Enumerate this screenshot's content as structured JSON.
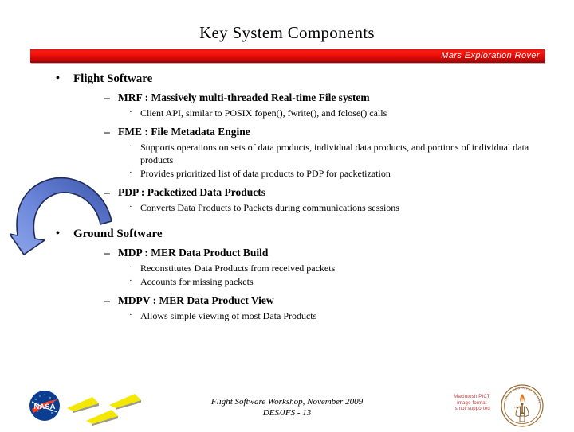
{
  "slide": {
    "title": "Key System Components",
    "banner_label": "Mars Exploration Rover",
    "banner_color": "#ee0d08",
    "arrow_color": "#6B86DB"
  },
  "content": [
    {
      "level": 1,
      "bullet": "•",
      "text": "Flight Software"
    },
    {
      "level": 2,
      "bullet": "–",
      "text": "MRF :  Massively multi-threaded Real-time File system"
    },
    {
      "level": 3,
      "bullet": "·",
      "text": "Client API, similar to POSIX fopen(), fwrite(), and fclose() calls"
    },
    {
      "level": 2,
      "bullet": "–",
      "text": "FME :  File Metadata Engine"
    },
    {
      "level": 3,
      "bullet": "·",
      "text": "Supports operations on sets of data products, individual data products, and portions of individual data products"
    },
    {
      "level": 3,
      "bullet": "·",
      "text": "Provides prioritized list of data products to PDP for packetization"
    },
    {
      "level": 2,
      "bullet": "–",
      "text": "PDP :  Packetized Data Products"
    },
    {
      "level": 3,
      "bullet": "·",
      "text": "Converts Data Products to Packets during communications sessions"
    },
    {
      "level": 1,
      "bullet": "•",
      "text": "Ground Software"
    },
    {
      "level": 2,
      "bullet": "–",
      "text": "MDP :  MER Data Product Build"
    },
    {
      "level": 3,
      "bullet": "·",
      "text": "Reconstitutes Data Products from received packets"
    },
    {
      "level": 3,
      "bullet": "·",
      "text": "Accounts for missing packets"
    },
    {
      "level": 2,
      "bullet": "–",
      "text": "MDPV : MER Data Product View"
    },
    {
      "level": 3,
      "bullet": "·",
      "text": "Allows simple viewing of most Data Products"
    }
  ],
  "footer": {
    "line1": "Flight Software Workshop, November 2009",
    "line2": "DES/JFS  - 13"
  },
  "logos": {
    "nasa_wordmark": "NASA",
    "pict_placeholder_line1": "Macintosh PICT",
    "pict_placeholder_line2": "image format",
    "pict_placeholder_line3": "is not supported",
    "caltech_seal_text": "CALIFORNIA INSTITUTE OF TECHNOLOGY",
    "caltech_seal_year": "1891"
  }
}
